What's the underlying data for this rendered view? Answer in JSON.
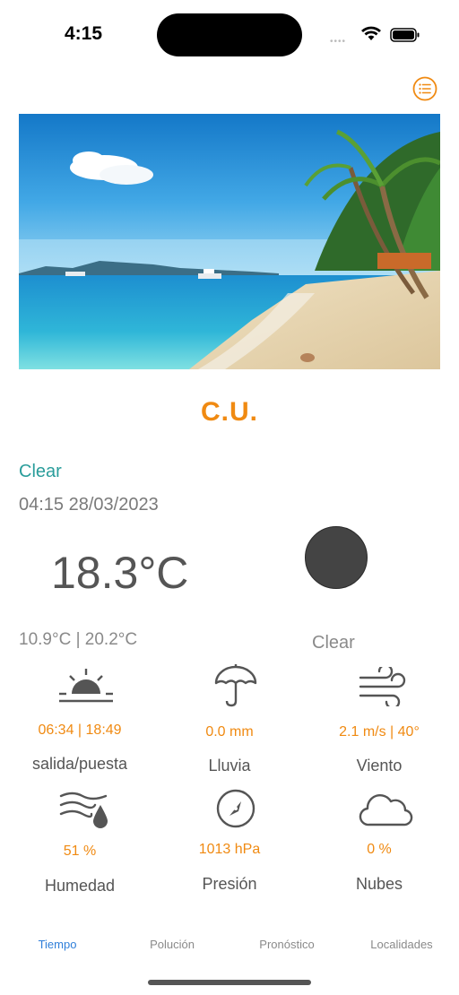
{
  "status_bar": {
    "time": "4:15"
  },
  "location": {
    "name": "C.U."
  },
  "current": {
    "condition": "Clear",
    "datetime": "04:15 28/03/2023",
    "temperature": "18.3°C",
    "min_max": "10.9°C | 20.2°C",
    "condition_label": "Clear"
  },
  "details": [
    {
      "icon": "sunrise-icon",
      "value": "06:34 | 18:49",
      "label": "salida/puesta"
    },
    {
      "icon": "umbrella-icon",
      "value": "0.0 mm",
      "label": "Lluvia"
    },
    {
      "icon": "wind-icon",
      "value": "2.1 m/s | 40°",
      "label": "Viento"
    },
    {
      "icon": "humidity-icon",
      "value": "51 %",
      "label": "Humedad"
    },
    {
      "icon": "pressure-gauge-icon",
      "value": "1013 hPa",
      "label": "Presión"
    },
    {
      "icon": "cloud-icon",
      "value": "0 %",
      "label": "Nubes"
    }
  ],
  "tabs": [
    {
      "label": "Tiempo",
      "active": true
    },
    {
      "label": "Polución",
      "active": false
    },
    {
      "label": "Pronóstico",
      "active": false
    },
    {
      "label": "Localidades",
      "active": false
    }
  ],
  "colors": {
    "accent": "#f08a12",
    "condition": "#2a9d9b",
    "tab_active": "#2f7fd9"
  }
}
